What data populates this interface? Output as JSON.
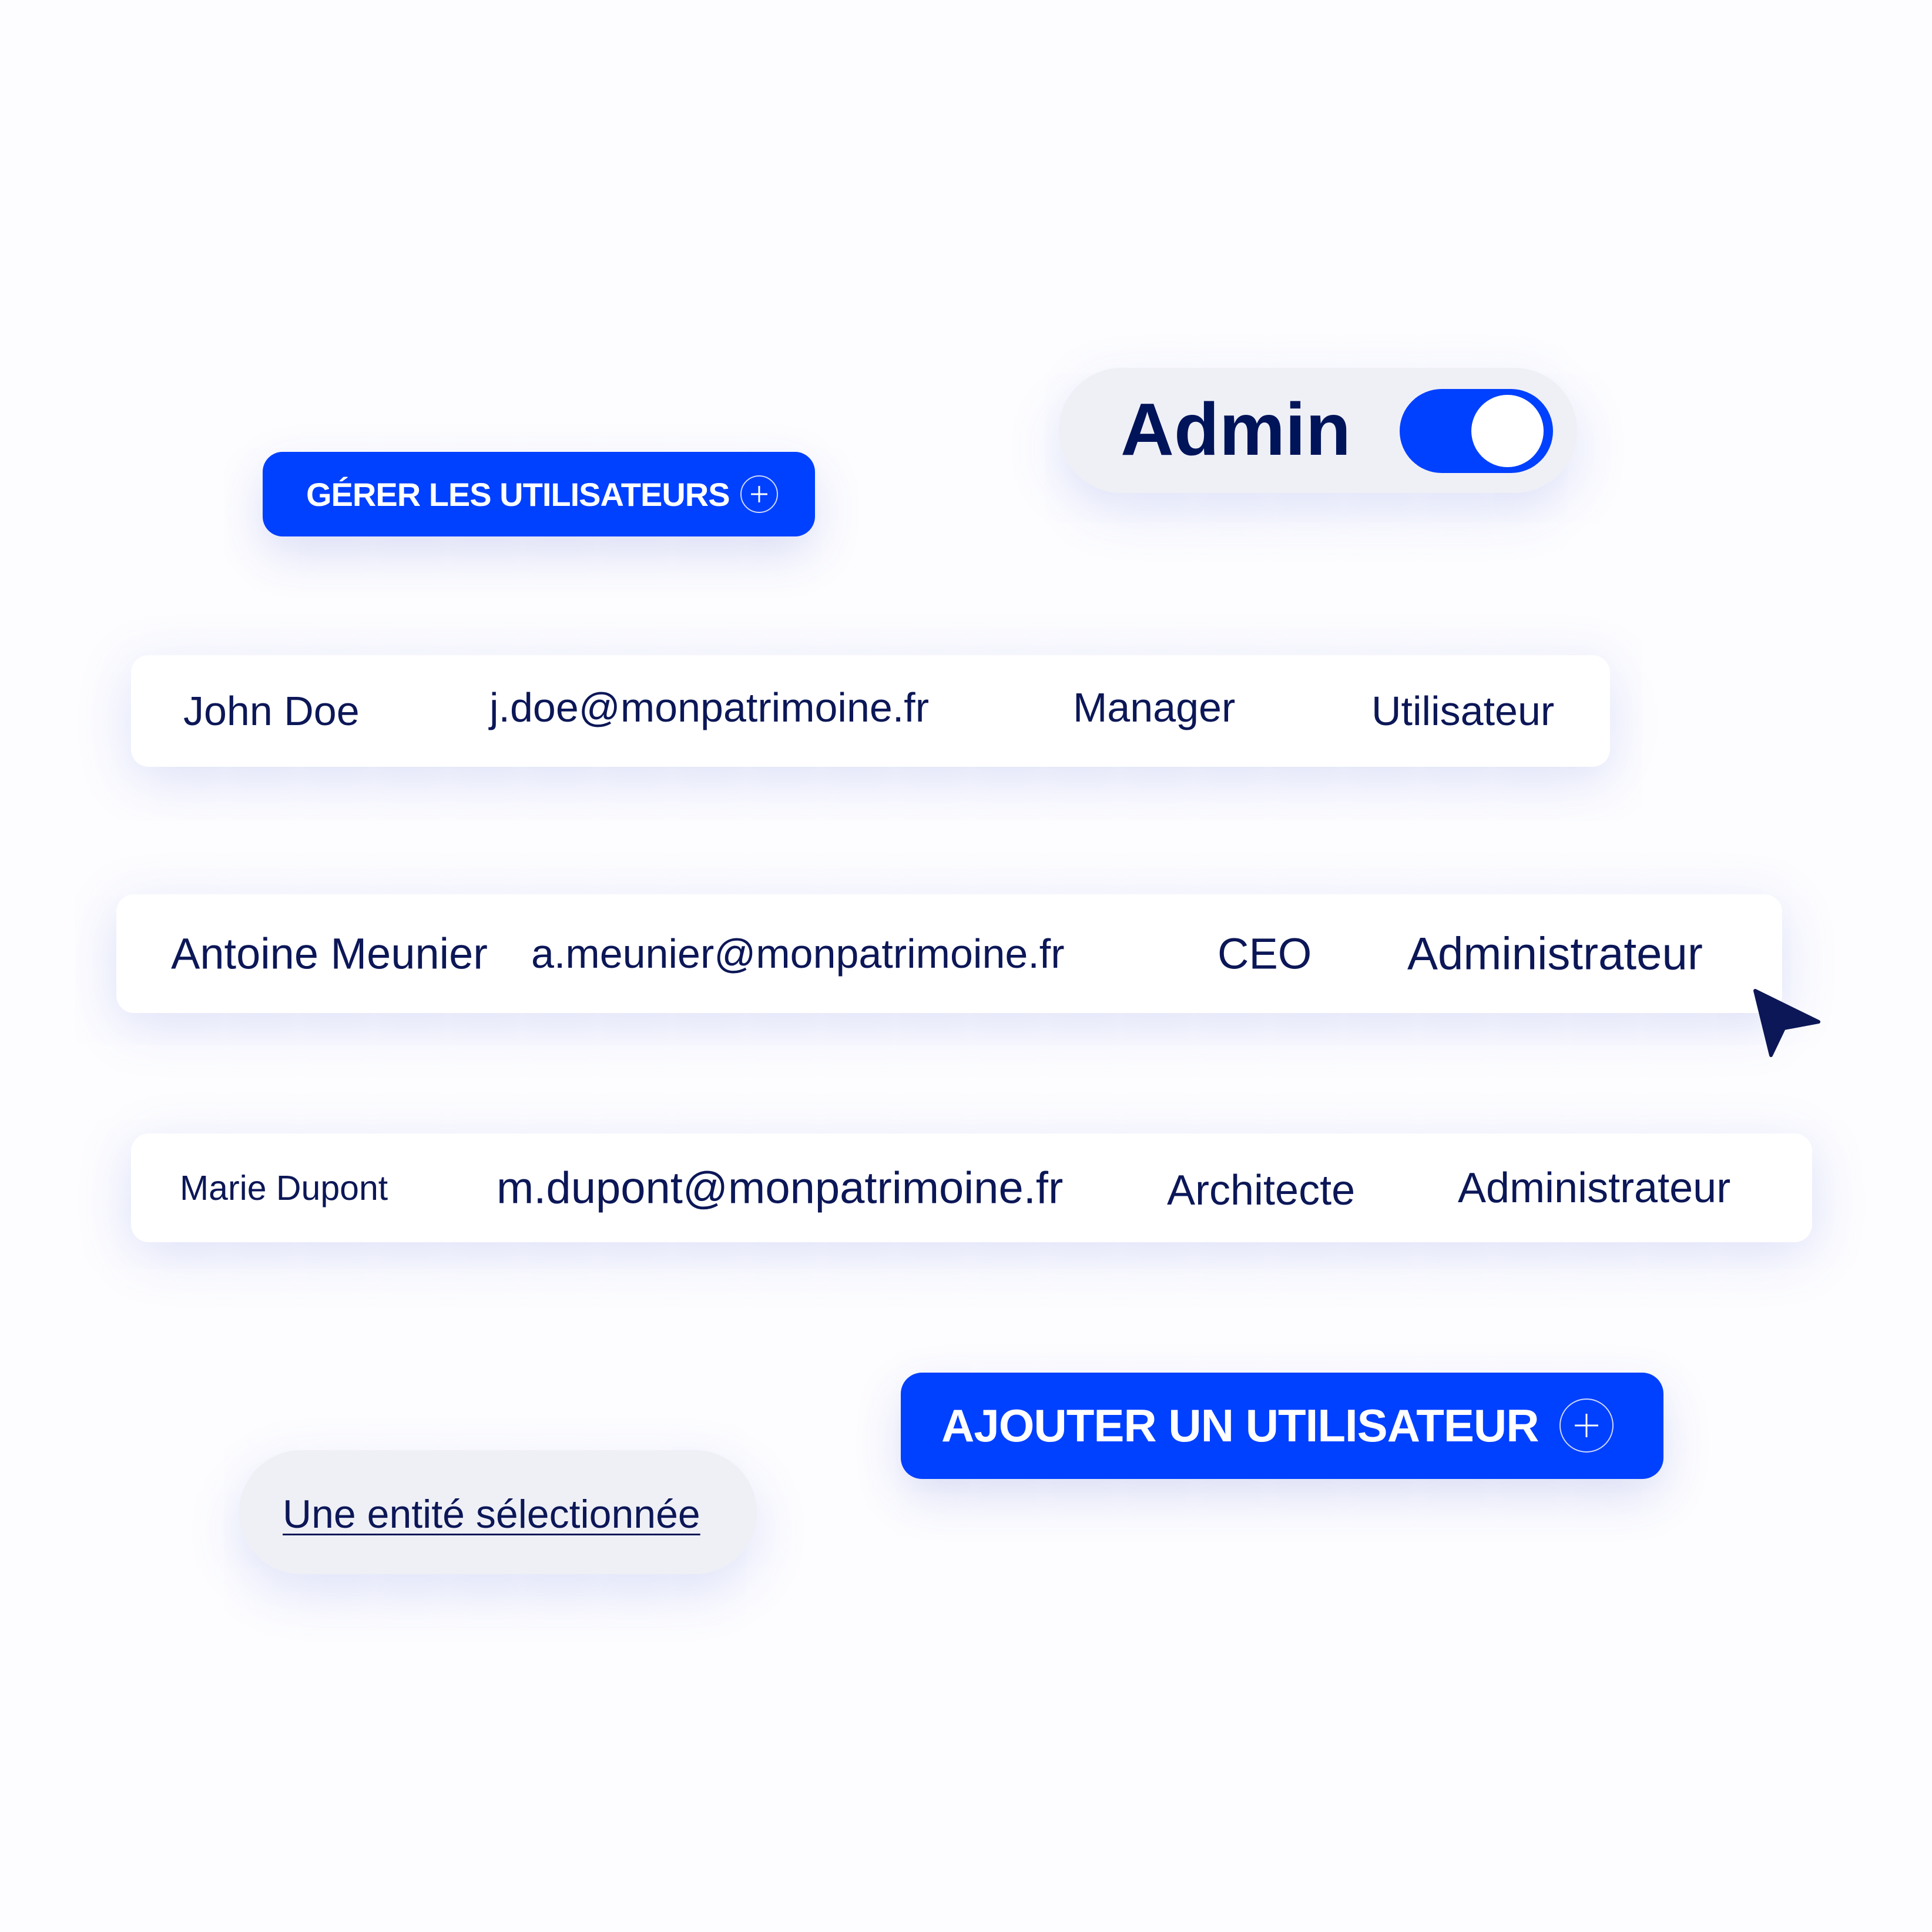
{
  "colors": {
    "accent": "#0040ff",
    "text": "#0c1757",
    "pill_bg": "#eff0f6"
  },
  "manage_button": {
    "label": "GÉRER LES UTILISATEURS",
    "icon": "plus-circle-icon"
  },
  "admin_toggle": {
    "label": "Admin",
    "on": true
  },
  "users": [
    {
      "name": "John Doe",
      "email": "j.doe@monpatrimoine.fr",
      "title": "Manager",
      "role": "Utilisateur"
    },
    {
      "name": "Antoine Meunier",
      "email": "a.meunier@monpatrimoine.fr",
      "title": "CEO",
      "role": "Administrateur"
    },
    {
      "name": "Marie Dupont",
      "email": "m.dupont@monpatrimoine.fr",
      "title": "Architecte",
      "role": "Administrateur"
    }
  ],
  "add_button": {
    "label": "AJOUTER UN UTILISATEUR",
    "icon": "plus-circle-icon"
  },
  "entity_link": {
    "label": "Une entité sélectionnée"
  },
  "cursor": {
    "icon": "cursor-arrow-icon"
  }
}
